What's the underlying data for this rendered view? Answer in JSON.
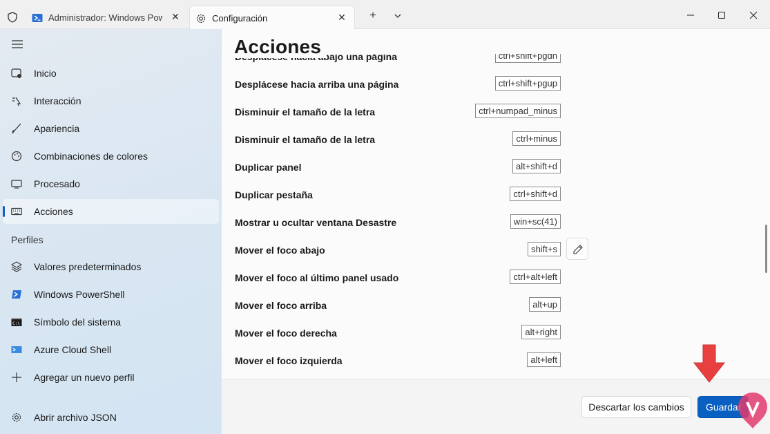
{
  "tabs": [
    {
      "title": "Administrador: Windows PowerShell",
      "icon": "powershell-icon"
    },
    {
      "title": "Configuración",
      "icon": "gear-icon"
    }
  ],
  "sidebar": {
    "items": [
      {
        "label": "Inicio",
        "icon": "home-icon"
      },
      {
        "label": "Interacción",
        "icon": "interaction-icon"
      },
      {
        "label": "Apariencia",
        "icon": "brush-icon"
      },
      {
        "label": "Combinaciones de colores",
        "icon": "palette-icon"
      },
      {
        "label": "Procesado",
        "icon": "monitor-icon"
      },
      {
        "label": "Acciones",
        "icon": "keyboard-icon",
        "active": true
      }
    ],
    "profiles_header": "Perfiles",
    "profiles": [
      {
        "label": "Valores predeterminados",
        "icon": "layers-icon"
      },
      {
        "label": "Windows PowerShell",
        "icon": "powershell-icon"
      },
      {
        "label": "Símbolo del sistema",
        "icon": "cmd-icon"
      },
      {
        "label": "Azure Cloud Shell",
        "icon": "azure-icon"
      },
      {
        "label": "Agregar un nuevo perfil",
        "icon": "plus-icon"
      }
    ],
    "open_json": "Abrir archivo JSON"
  },
  "main": {
    "title": "Acciones",
    "actions": [
      {
        "name": "Desplácese hacia abajo una página",
        "key": "ctrl+shift+pgdn"
      },
      {
        "name": "Desplácese hacia arriba una página",
        "key": "ctrl+shift+pgup"
      },
      {
        "name": "Disminuir el tamaño de la letra",
        "key": "ctrl+numpad_minus"
      },
      {
        "name": "Disminuir el tamaño de la letra",
        "key": "ctrl+minus"
      },
      {
        "name": "Duplicar panel",
        "key": "alt+shift+d"
      },
      {
        "name": "Duplicar pestaña",
        "key": "ctrl+shift+d"
      },
      {
        "name": "Mostrar u ocultar ventana Desastre",
        "key": "win+sc(41)"
      },
      {
        "name": "Mover el foco abajo",
        "key": "shift+s",
        "editable": true
      },
      {
        "name": "Mover el foco al último panel usado",
        "key": "ctrl+alt+left"
      },
      {
        "name": "Mover el foco arriba",
        "key": "alt+up"
      },
      {
        "name": "Mover el foco derecha",
        "key": "alt+right"
      },
      {
        "name": "Mover el foco izquierda",
        "key": "alt+left"
      }
    ]
  },
  "footer": {
    "discard_label": "Descartar los cambios",
    "save_label": "Guardar"
  },
  "colors": {
    "accent": "#0a5fc2",
    "arrow": "#e8403f"
  }
}
